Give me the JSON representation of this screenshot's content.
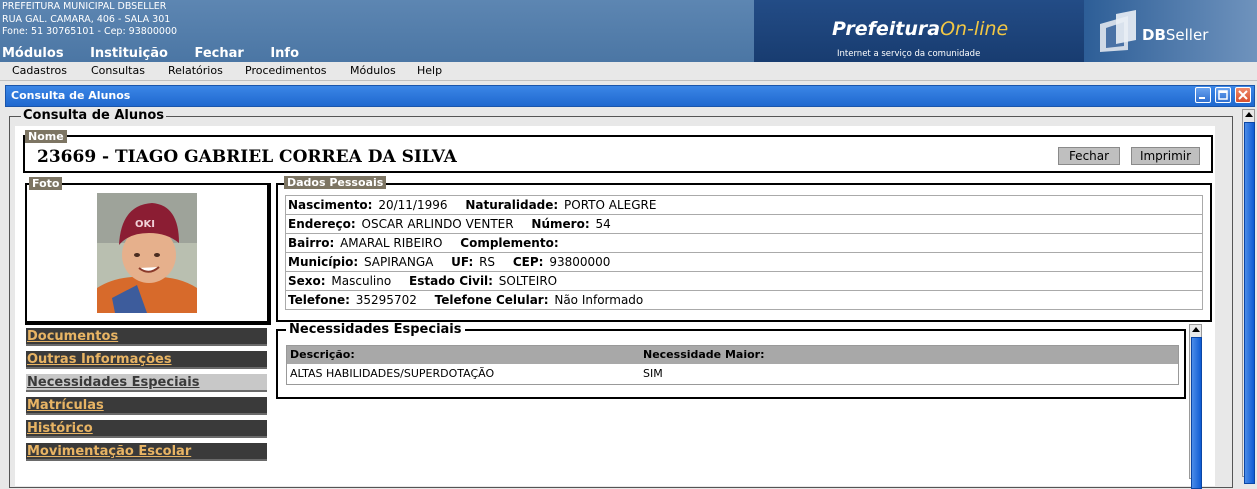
{
  "header": {
    "org_name": "PREFEITURA MUNICIPAL DBSELLER",
    "org_address": "RUA GAL. CAMARA, 406 - SALA 301",
    "org_phone": "Fone: 51 30765101  -  Cep: 93800000",
    "top_nav": [
      "Módulos",
      "Instituição",
      "Fechar",
      "Info"
    ],
    "portal_brand_main": "Prefeitura",
    "portal_brand_accent": "On-line",
    "portal_tagline": "Internet a serviço da comunidade",
    "vendor_db": "DB",
    "vendor_seller": "Seller"
  },
  "menubar": [
    "Cadastros",
    "Consultas",
    "Relatórios",
    "Procedimentos",
    "Módulos",
    "Help"
  ],
  "window": {
    "title": "Consulta de Alunos"
  },
  "main": {
    "fieldset_title": "Consulta de Alunos",
    "nome_label": "Nome",
    "student_name_line": "23669  -  TIAGO GABRIEL CORREA DA SILVA",
    "fechar_label": "Fechar",
    "imprimir_label": "Imprimir",
    "foto_label": "Foto",
    "dados_label": "Dados Pessoais",
    "dados": {
      "nascimento_l": "Nascimento:",
      "nascimento_v": "20/11/1996",
      "naturalidade_l": "Naturalidade:",
      "naturalidade_v": "PORTO ALEGRE",
      "endereco_l": "Endereço:",
      "endereco_v": "OSCAR ARLINDO VENTER",
      "numero_l": "Número:",
      "numero_v": "54",
      "bairro_l": "Bairro:",
      "bairro_v": "AMARAL RIBEIRO",
      "complemento_l": "Complemento:",
      "municipio_l": "Município:",
      "municipio_v": "SAPIRANGA",
      "uf_l": "UF:",
      "uf_v": "RS",
      "cep_l": "CEP:",
      "cep_v": "93800000",
      "sexo_l": "Sexo:",
      "sexo_v": "Masculino",
      "estado_civil_l": "Estado Civil:",
      "estado_civil_v": "SOLTEIRO",
      "telefone_l": "Telefone:",
      "telefone_v": "35295702",
      "celular_l": "Telefone Celular:",
      "celular_v": "Não Informado"
    },
    "side_links": [
      "Documentos",
      "Outras Informações",
      "Necessidades Especiais",
      "Matrículas",
      "Histórico",
      "Movimentação Escolar"
    ],
    "necessidades": {
      "title": "Necessidades Especiais",
      "col_descricao": "Descrição:",
      "col_maior": "Necessidade Maior:",
      "rows": [
        {
          "descricao": "ALTAS HABILIDADES/SUPERDOTAÇÃO",
          "maior": "SIM"
        }
      ]
    }
  },
  "colors": {
    "banner_blue": "#4b76a4",
    "titlebar_blue": "#1f68cf",
    "link_gold": "#e8b464",
    "tag_brown": "#7d7563"
  }
}
